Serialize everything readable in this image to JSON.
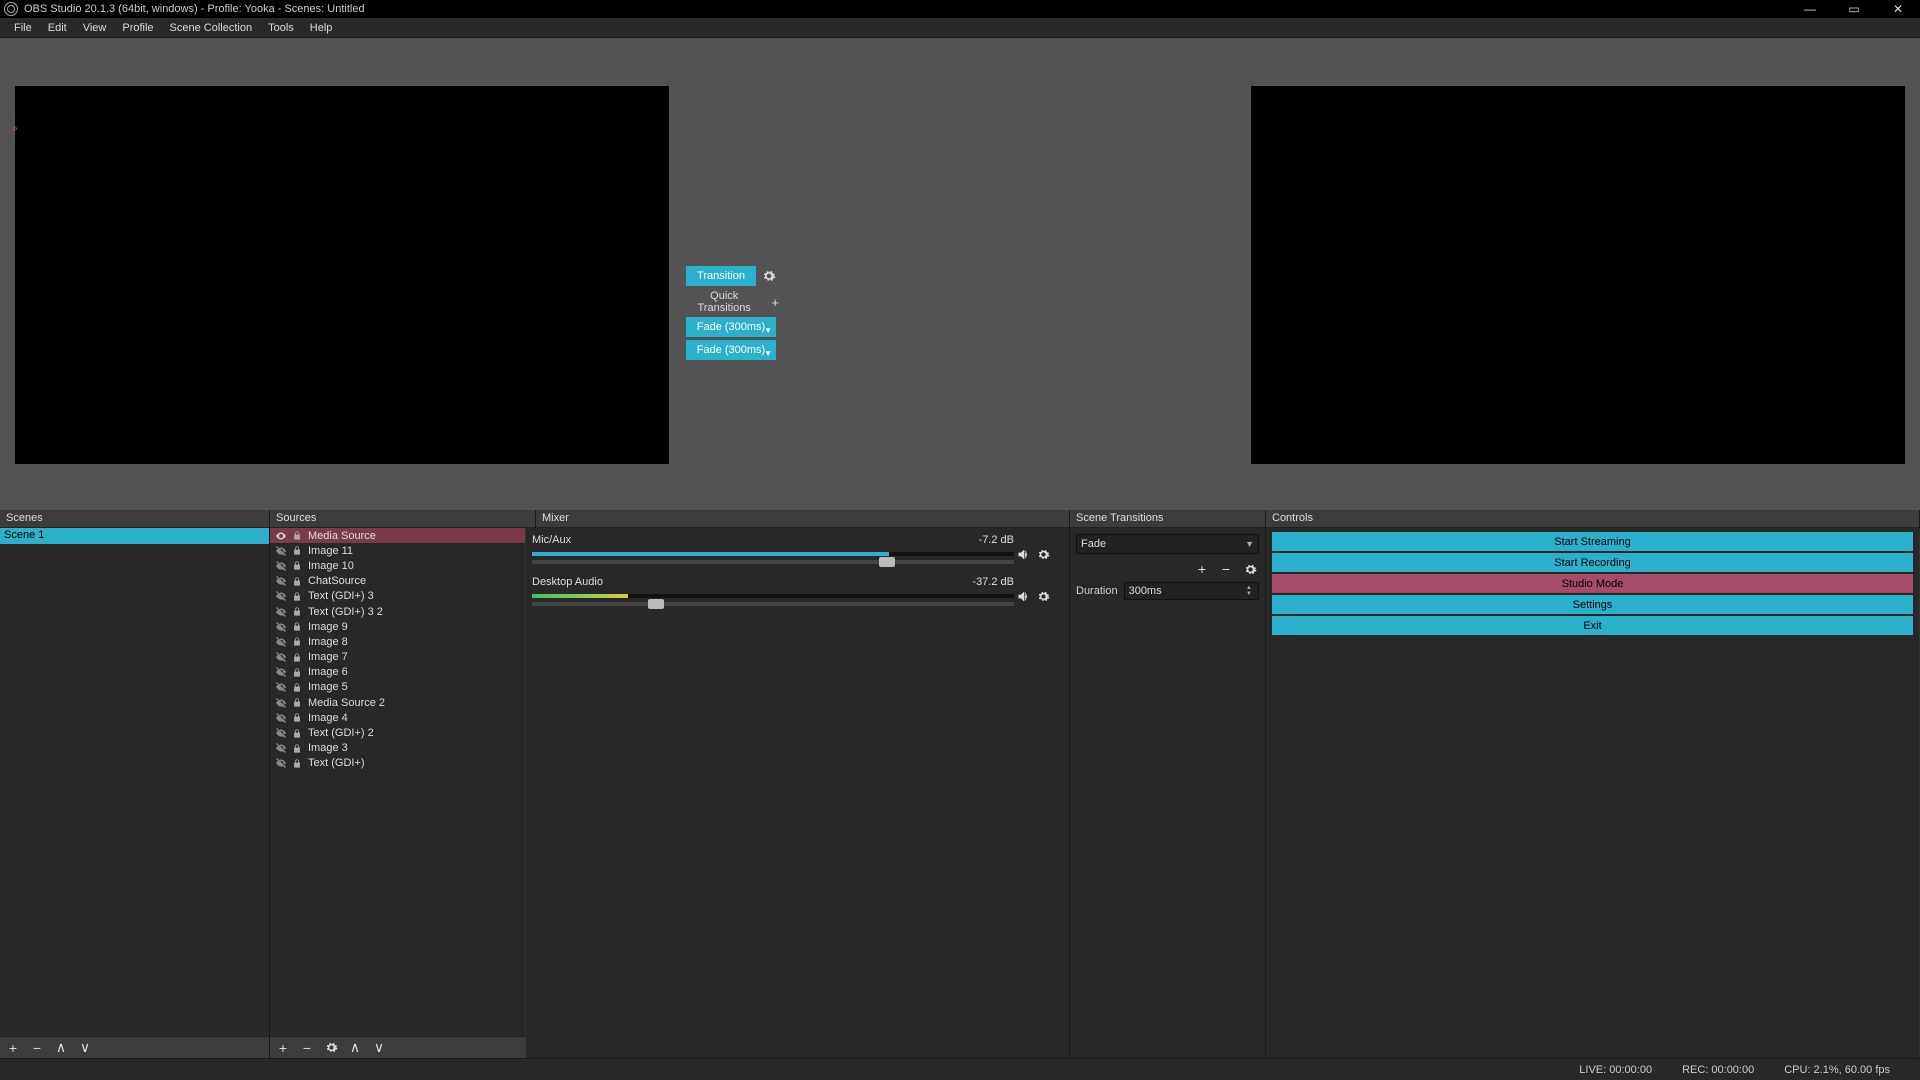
{
  "title": "OBS Studio 20.1.3 (64bit, windows) - Profile: Yooka - Scenes: Untitled",
  "menu": [
    "File",
    "Edit",
    "View",
    "Profile",
    "Scene Collection",
    "Tools",
    "Help"
  ],
  "transition_center": {
    "button": "Transition",
    "quick_label": "Quick Transitions",
    "items": [
      "Fade (300ms)",
      "Fade (300ms)"
    ]
  },
  "panels": {
    "scenes": {
      "title": "Scenes",
      "items": [
        "Scene 1"
      ]
    },
    "sources": {
      "title": "Sources",
      "items": [
        {
          "name": "Media Source",
          "visible": true,
          "selected": true
        },
        {
          "name": "Image 11",
          "visible": false
        },
        {
          "name": "Image 10",
          "visible": false
        },
        {
          "name": "ChatSource",
          "visible": false
        },
        {
          "name": "Text (GDI+) 3",
          "visible": false
        },
        {
          "name": "Text (GDI+) 3 2",
          "visible": false
        },
        {
          "name": "Image 9",
          "visible": false
        },
        {
          "name": "Image 8",
          "visible": false
        },
        {
          "name": "Image 7",
          "visible": false
        },
        {
          "name": "Image 6",
          "visible": false
        },
        {
          "name": "Image 5",
          "visible": false
        },
        {
          "name": "Media Source 2",
          "visible": false
        },
        {
          "name": "Image 4",
          "visible": false
        },
        {
          "name": "Text (GDI+) 2",
          "visible": false
        },
        {
          "name": "Image 3",
          "visible": false
        },
        {
          "name": "Text (GDI+)",
          "visible": false
        }
      ]
    },
    "mixer": {
      "title": "Mixer",
      "channels": [
        {
          "name": "Mic/Aux",
          "db": "-7.2 dB",
          "meter_pct": 74,
          "meter_color": "#2bb1cc",
          "slider_pct": 72
        },
        {
          "name": "Desktop Audio",
          "db": "-37.2 dB",
          "meter_pct": 20,
          "meter_color": "linear-gradient(90deg,#3cc06c 0%,#d8d040 100%)",
          "slider_pct": 24
        }
      ]
    },
    "scene_transitions": {
      "title": "Scene Transitions",
      "selected": "Fade",
      "duration_label": "Duration",
      "duration_value": "300ms"
    },
    "controls": {
      "title": "Controls",
      "buttons": [
        {
          "label": "Start Streaming",
          "kind": "normal"
        },
        {
          "label": "Start Recording",
          "kind": "normal"
        },
        {
          "label": "Studio Mode",
          "kind": "studio"
        },
        {
          "label": "Settings",
          "kind": "normal"
        },
        {
          "label": "Exit",
          "kind": "normal"
        }
      ]
    }
  },
  "status": {
    "live": "LIVE: 00:00:00",
    "rec": "REC: 00:00:00",
    "cpu": "CPU: 2.1%, 60.00 fps"
  }
}
